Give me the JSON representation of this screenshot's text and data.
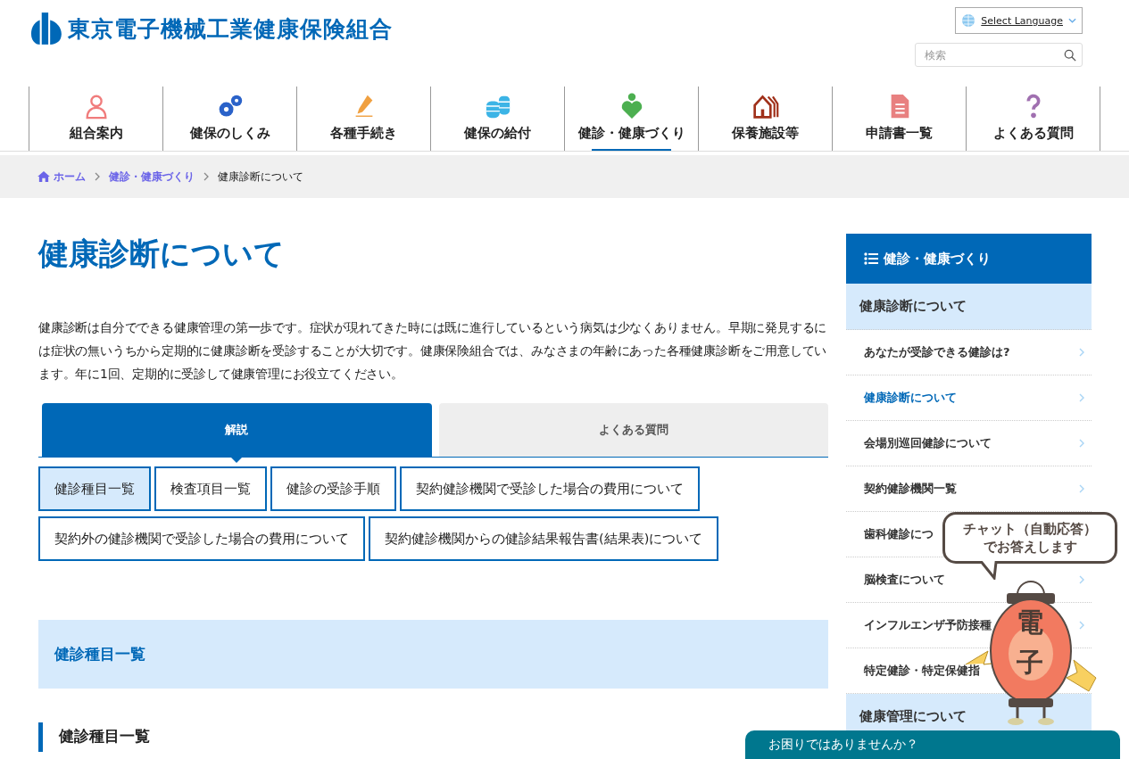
{
  "site": {
    "title": "東京電子機械工業健康保険組合"
  },
  "language": {
    "label": "Select Language"
  },
  "search": {
    "placeholder": "検索"
  },
  "nav": [
    {
      "label": "組合案内",
      "kind": "person",
      "selected": false
    },
    {
      "label": "健保のしくみ",
      "kind": "gears",
      "selected": false
    },
    {
      "label": "各種手続き",
      "kind": "pen",
      "selected": false
    },
    {
      "label": "健保の給付",
      "kind": "coins",
      "selected": false
    },
    {
      "label": "健診・健康づくり",
      "kind": "heart",
      "selected": true
    },
    {
      "label": "保養施設等",
      "kind": "house",
      "selected": false
    },
    {
      "label": "申請書一覧",
      "kind": "doc",
      "selected": false
    },
    {
      "label": "よくある質問",
      "kind": "question",
      "selected": false
    }
  ],
  "breadcrumb": [
    {
      "label": "ホーム",
      "kind": "home"
    },
    {
      "label": "健診・健康づくり",
      "kind": "link"
    },
    {
      "label": "健康診断について",
      "kind": "current"
    }
  ],
  "page": {
    "title": "健康診断について",
    "intro": "健康診断は自分でできる健康管理の第一歩です。症状が現れてきた時には既に進行しているという病気は少なくありません。早期に発見するには症状の無いうちから定期的に健康診断を受診することが大切です。健康保険組合では、みなさまの年齢にあった各種健康診断をご用意しています。年に1回、定期的に受診して健康管理にお役立てください。"
  },
  "tabs": [
    {
      "label": "解説",
      "selected": true
    },
    {
      "label": "よくある質問",
      "selected": false
    }
  ],
  "subnav": [
    {
      "label": "健診種目一覧",
      "selected": true
    },
    {
      "label": "検査項目一覧",
      "selected": false
    },
    {
      "label": "健診の受診手順",
      "selected": false
    },
    {
      "label": "契約健診機関で受診した場合の費用について",
      "selected": false
    },
    {
      "label": "契約外の健診機関で受診した場合の費用について",
      "selected": false
    },
    {
      "label": "契約健診機関からの健診結果報告書(結果表)について",
      "selected": false
    }
  ],
  "section": {
    "title": "健診種目一覧",
    "heading": "健診種目一覧"
  },
  "sidebar": {
    "title": "健診・健康づくり",
    "groups": [
      {
        "label": "健康診断について",
        "children": [
          {
            "label": "あなたが受診できる健診は?",
            "selected": false,
            "arrow": true
          },
          {
            "label": "健康診断について",
            "selected": true,
            "arrow": true
          },
          {
            "label": "会場別巡回健診について",
            "selected": false,
            "arrow": true
          },
          {
            "label": "契約健診機関一覧",
            "selected": false,
            "arrow": true
          },
          {
            "label": "歯科健診につ",
            "selected": false
          },
          {
            "label": "脳検査について",
            "selected": false,
            "arrow": true
          },
          {
            "label": "インフルエンザ予防接種",
            "selected": false,
            "arrow": true
          },
          {
            "label": "特定健診・特定保健指",
            "selected": false
          }
        ]
      },
      {
        "label": "健康管理について"
      }
    ]
  },
  "chat": {
    "bubble": [
      "チャット（自動応答）",
      "でお答えします"
    ],
    "lantern": [
      "電",
      "子"
    ],
    "bar": "お困りではありませんか？"
  }
}
